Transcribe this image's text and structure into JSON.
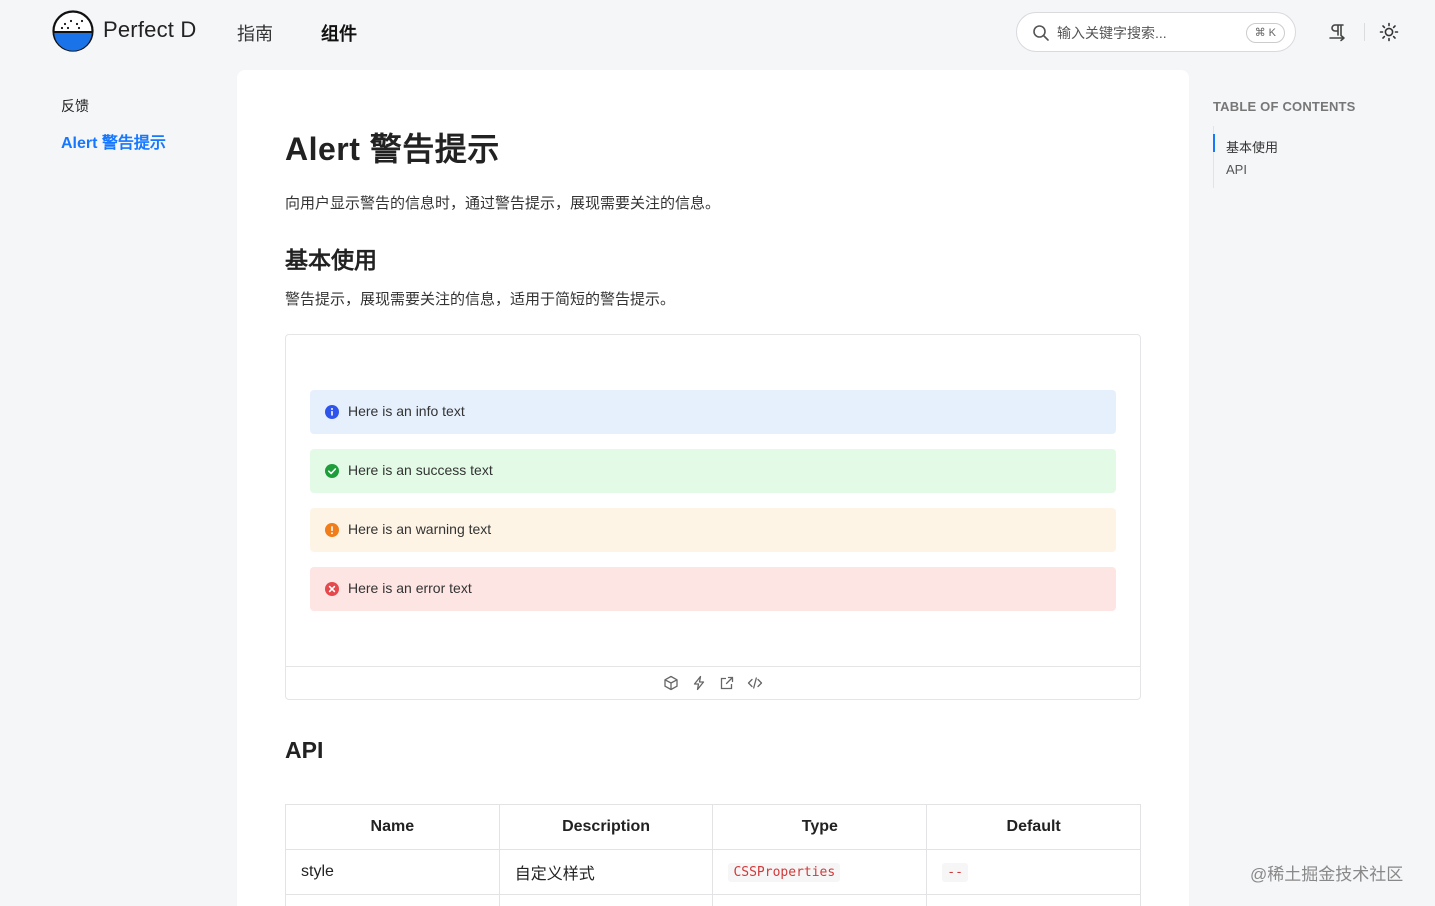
{
  "header": {
    "brand": "Perfect D",
    "nav": [
      {
        "label": "指南"
      },
      {
        "label": "组件"
      }
    ],
    "search": {
      "placeholder": "输入关键字搜索...",
      "shortcut": "⌘ K"
    }
  },
  "sidebar": {
    "group_label": "反馈",
    "items": [
      {
        "label": "Alert 警告提示",
        "active": true
      }
    ]
  },
  "main": {
    "title": "Alert 警告提示",
    "intro": "向用户显示警告的信息时，通过警告提示，展现需要关注的信息。",
    "basic": {
      "heading": "基本使用",
      "description": "警告提示，展现需要关注的信息，适用于简短的警告提示。",
      "alerts": [
        {
          "type": "info",
          "text": "Here is an info text",
          "color": "#2f54eb"
        },
        {
          "type": "success",
          "text": "Here is an success text",
          "color": "#1e9e3a"
        },
        {
          "type": "warning",
          "text": "Here is an warning text",
          "color": "#f07c1a"
        },
        {
          "type": "error",
          "text": "Here is an error text",
          "color": "#e5484d"
        }
      ]
    },
    "api": {
      "heading": "API",
      "columns": [
        "Name",
        "Description",
        "Type",
        "Default"
      ],
      "rows": [
        {
          "name": "style",
          "description": "自定义样式",
          "type": "CSSProperties",
          "default": "--"
        }
      ]
    }
  },
  "toc": {
    "title": "TABLE OF CONTENTS",
    "items": [
      {
        "label": "基本使用"
      },
      {
        "label": "API"
      }
    ]
  },
  "watermark": "@稀土掘金技术社区",
  "colors": {
    "accent": "#1677ff"
  }
}
